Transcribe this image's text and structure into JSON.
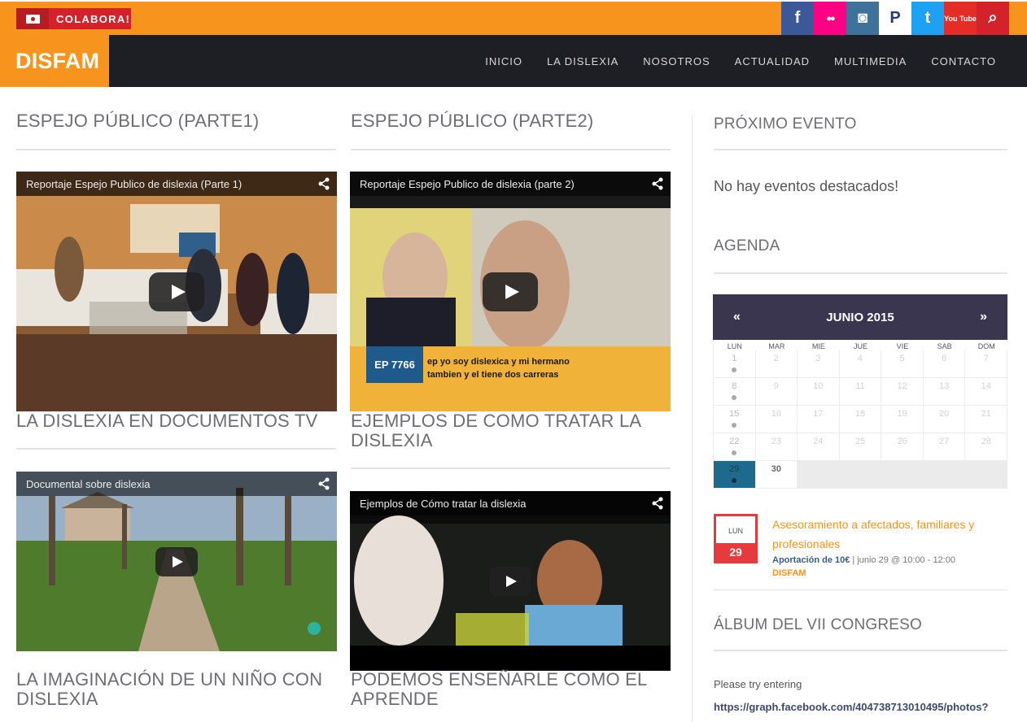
{
  "topbar": {
    "donate_label": "COLABORA!",
    "social": [
      {
        "icon": "facebook-icon",
        "glyph": "f",
        "color": "#3b5998"
      },
      {
        "icon": "flickr-icon",
        "glyph": "●●",
        "color": "#ff0084"
      },
      {
        "icon": "instagram-icon",
        "glyph": "◙",
        "color": "#3f729b"
      },
      {
        "icon": "paypal-icon",
        "glyph": "P",
        "color": "#ffffff"
      },
      {
        "icon": "twitter-icon",
        "glyph": "t",
        "color": "#1da1f2"
      },
      {
        "icon": "youtube-icon",
        "glyph": "You Tube",
        "color": "#e52d27"
      },
      {
        "icon": "search-icon",
        "glyph": "⌕",
        "color": "#d3222a"
      }
    ]
  },
  "nav": {
    "logo": "DISFAM",
    "items": [
      "INICIO",
      "LA DISLEXIA",
      "NOSOTROS",
      "ACTUALIDAD",
      "MULTIMEDIA",
      "CONTACTO"
    ]
  },
  "videos": [
    {
      "section_title": "ESPEJO PÚBLICO (PARTE1)",
      "video_title": "Reportaje Espejo Publico de dislexia (Parte 1)"
    },
    {
      "section_title": "ESPEJO PÚBLICO (PARTE2)",
      "video_title": "Reportaje Espejo Publico de dislexia (parte 2)",
      "caption_line1": "ep yo soy dislexica y mi hermano",
      "caption_line2": "tambien y el tiene dos carreras",
      "badge": "EP 7766"
    },
    {
      "section_title": "LA DISLEXIA EN DOCUMENTOS TV",
      "video_title": "Documental sobre dislexia"
    },
    {
      "section_title": "EJEMPLOS DE COMO TRATAR LA DISLEXIA",
      "video_title": "Ejemplos de Cómo tratar la dislexia"
    },
    {
      "section_title": "LA IMAGINACIÓN DE UN NIÑO CON DISLEXIA"
    },
    {
      "section_title": "PODEMOS ENSEÑARLE COMO EL APRENDE"
    }
  ],
  "sidebar": {
    "next_event_title": "PRÓXIMO EVENTO",
    "no_events": "No hay eventos destacados!",
    "agenda_title": "AGENDA",
    "calendar": {
      "month": "JUNIO 2015",
      "prev": "«",
      "next": "»",
      "weekdays": [
        "LUN",
        "MAR",
        "MIE",
        "JUE",
        "VIE",
        "SAB",
        "DOM"
      ],
      "days": [
        "1",
        "2",
        "3",
        "4",
        "5",
        "6",
        "7",
        "8",
        "9",
        "10",
        "11",
        "12",
        "13",
        "14",
        "15",
        "16",
        "17",
        "18",
        "19",
        "20",
        "21",
        "22",
        "23",
        "24",
        "25",
        "26",
        "27",
        "28",
        "29",
        "30"
      ],
      "event_days": [
        "1",
        "8",
        "15",
        "22",
        "29"
      ],
      "today": "29"
    },
    "event": {
      "weekday": "LUN",
      "day": "29",
      "title": "Asesoramiento a afectados, familiares y profesionales",
      "price": "Aportación de 10€",
      "when": " | junio 29 @ 10:00 - 12:00",
      "org": "DISFAM"
    },
    "album_title": "ÁLBUM DEL VII CONGRESO",
    "album_hint": "Please try entering",
    "album_url": "https://graph.facebook.com/404738713010495/photos?"
  }
}
